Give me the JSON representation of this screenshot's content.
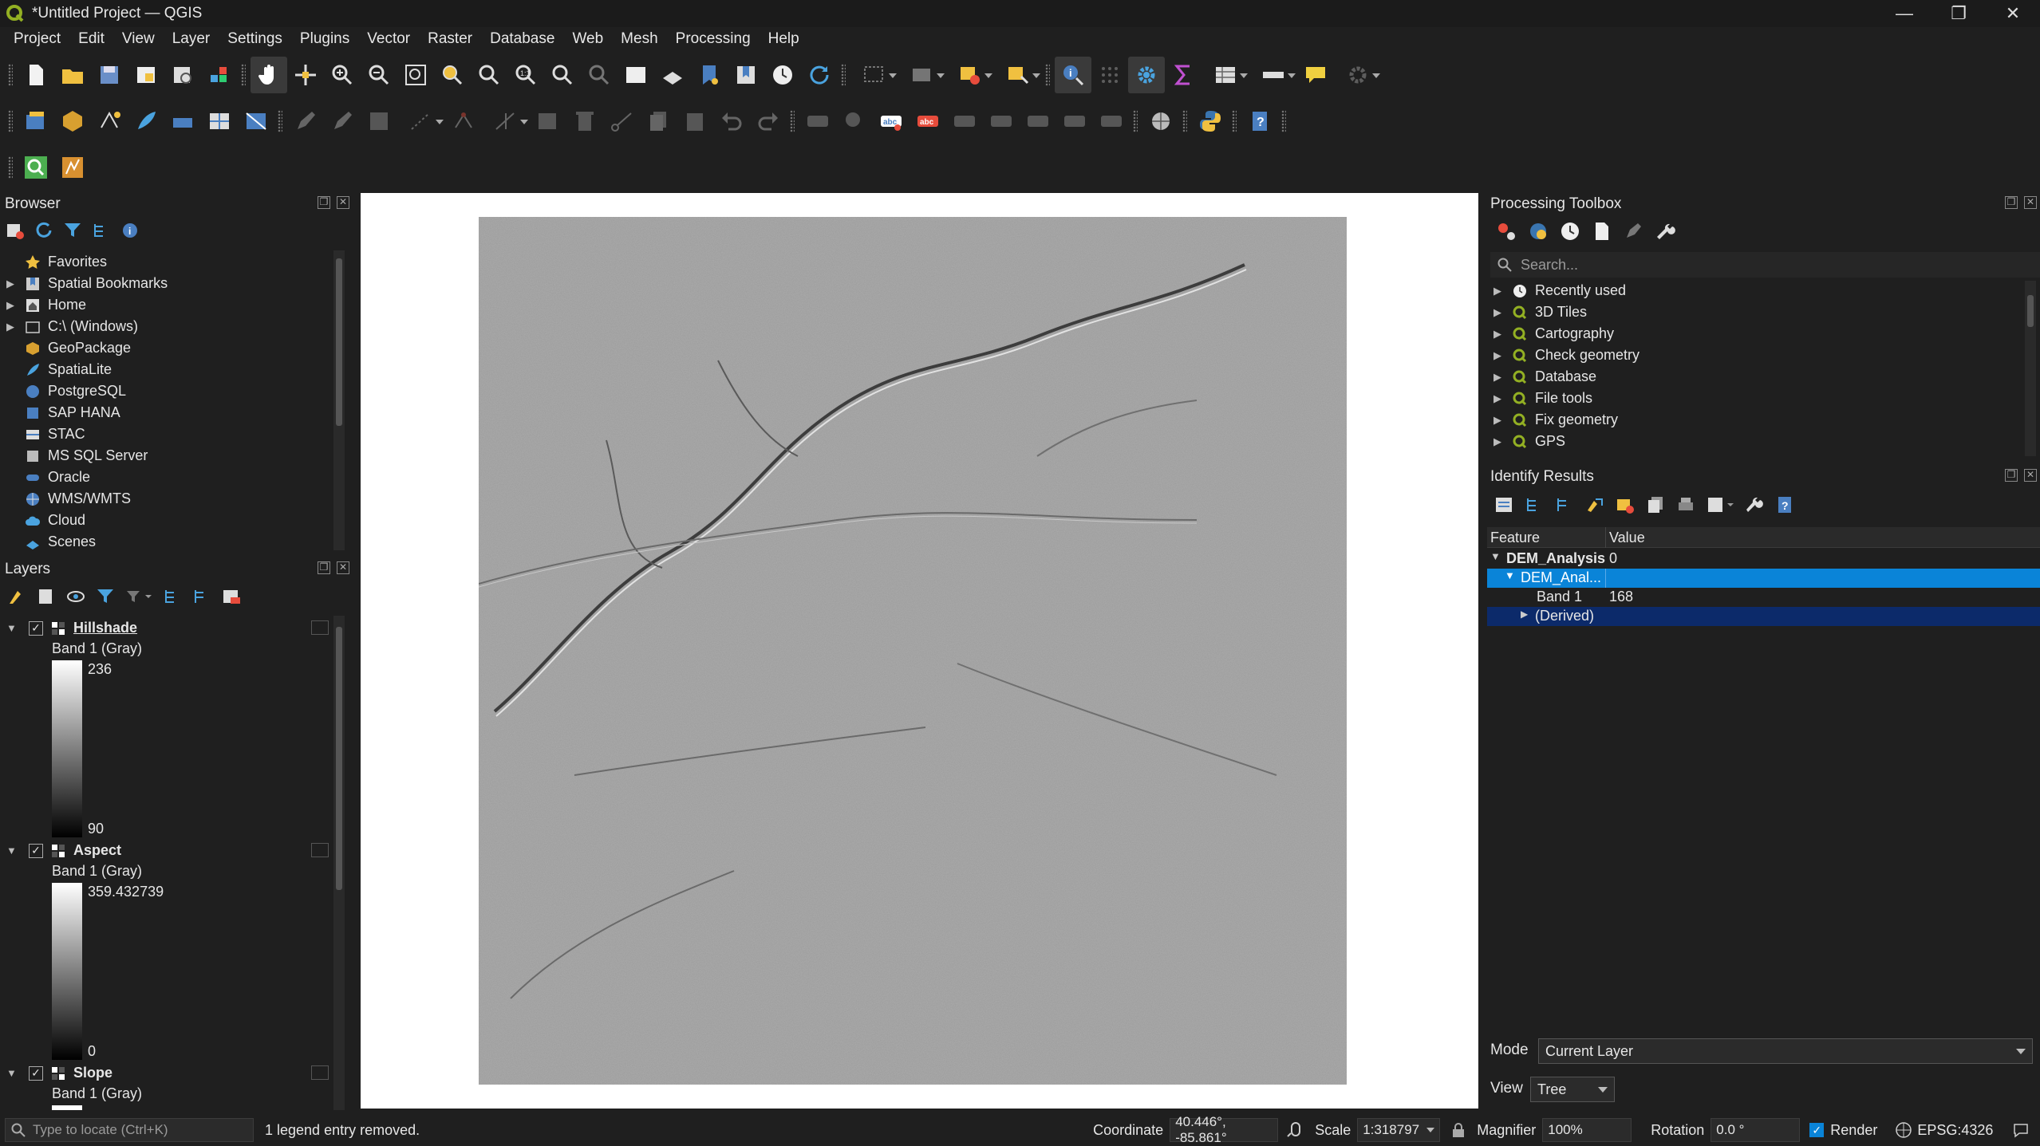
{
  "window": {
    "title": "*Untitled Project — QGIS",
    "minimize": "—",
    "maximize": "❐",
    "close": "✕"
  },
  "menu": [
    "Project",
    "Edit",
    "View",
    "Layer",
    "Settings",
    "Plugins",
    "Vector",
    "Raster",
    "Database",
    "Web",
    "Mesh",
    "Processing",
    "Help"
  ],
  "browser": {
    "title": "Browser",
    "items": [
      {
        "label": "Favorites",
        "icon": "star-icon"
      },
      {
        "label": "Spatial Bookmarks",
        "icon": "bookmark-icon"
      },
      {
        "label": "Home",
        "icon": "home-icon"
      },
      {
        "label": "C:\\ (Windows)",
        "icon": "folder-icon"
      },
      {
        "label": "GeoPackage",
        "icon": "geopackage-icon"
      },
      {
        "label": "SpatiaLite",
        "icon": "spatialite-icon"
      },
      {
        "label": "PostgreSQL",
        "icon": "postgresql-icon"
      },
      {
        "label": "SAP HANA",
        "icon": "sap-hana-icon"
      },
      {
        "label": "STAC",
        "icon": "stac-icon"
      },
      {
        "label": "MS SQL Server",
        "icon": "mssql-icon"
      },
      {
        "label": "Oracle",
        "icon": "oracle-icon"
      },
      {
        "label": "WMS/WMTS",
        "icon": "globe-icon"
      },
      {
        "label": "Cloud",
        "icon": "cloud-icon"
      },
      {
        "label": "Scenes",
        "icon": "scenes-icon"
      }
    ]
  },
  "layers": {
    "title": "Layers",
    "items": [
      {
        "name": "Hillshade",
        "band": "Band 1 (Gray)",
        "max": "236",
        "min": "90"
      },
      {
        "name": "Aspect",
        "band": "Band 1 (Gray)",
        "max": "359.432739",
        "min": "0"
      },
      {
        "name": "Slope",
        "band": "Band 1 (Gray)"
      }
    ]
  },
  "toolbox": {
    "title": "Processing Toolbox",
    "search_placeholder": "Search...",
    "items": [
      "Recently used",
      "3D Tiles",
      "Cartography",
      "Check geometry",
      "Database",
      "File tools",
      "Fix geometry",
      "GPS"
    ]
  },
  "identify": {
    "title": "Identify Results",
    "col_feature": "Feature",
    "col_value": "Value",
    "rows": [
      {
        "feature": "DEM_Analysis",
        "value": "0"
      },
      {
        "feature": "DEM_Anal...",
        "value": ""
      },
      {
        "feature": "Band 1",
        "value": "168"
      },
      {
        "feature": "(Derived)",
        "value": ""
      }
    ],
    "mode_label": "Mode",
    "mode_value": "Current Layer",
    "view_label": "View",
    "view_value": "Tree"
  },
  "status": {
    "locate_placeholder": "Type to locate (Ctrl+K)",
    "message": "1 legend entry removed.",
    "coordinate_label": "Coordinate",
    "coordinate_value": "40.446°, -85.861°",
    "scale_label": "Scale",
    "scale_value": "1:318797",
    "magnifier_label": "Magnifier",
    "magnifier_value": "100%",
    "rotation_label": "Rotation",
    "rotation_value": "0.0 °",
    "render_label": "Render",
    "crs": "EPSG:4326"
  },
  "colors": {
    "accent": "#0a84d8",
    "selection_dark": "#0c2a6a",
    "map_bg": "#ffffff",
    "raster_gray": "#9a9a9a"
  }
}
